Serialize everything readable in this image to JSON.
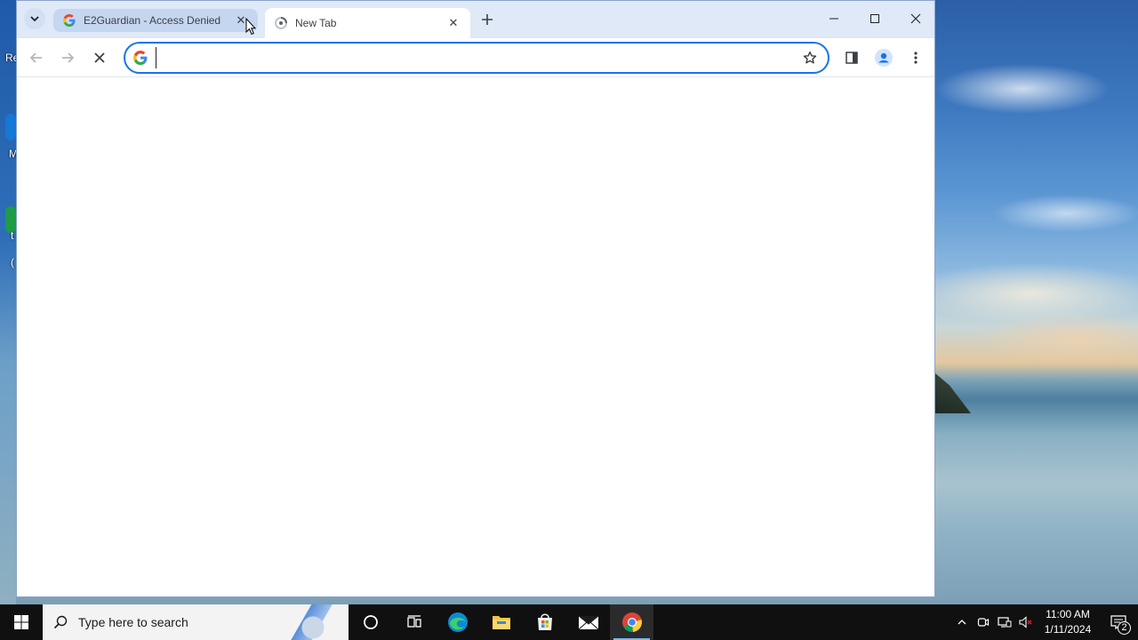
{
  "desktop": {
    "left_edge_label_fragment": "Re",
    "fragment_2": "M",
    "fragment_3": "t",
    "fragment_4": "("
  },
  "browser": {
    "tabs": [
      {
        "title": "E2Guardian - Access Denied",
        "favicon": "google-g-icon",
        "state": "inactive",
        "close_label": "✕"
      },
      {
        "title": "New Tab",
        "favicon": "loading-spinner-icon",
        "state": "active",
        "close_label": "✕"
      }
    ],
    "new_tab_label": "+",
    "window_controls": {
      "minimize": "minimize-icon",
      "maximize": "maximize-icon",
      "close": "close-icon"
    },
    "toolbar": {
      "back": "back-arrow-icon",
      "forward": "forward-arrow-icon",
      "stop": "stop-loading-icon",
      "address_value": "",
      "address_placeholder": "",
      "bookmark": "star-outline-icon",
      "side_panel": "side-panel-icon",
      "profile": "profile-avatar-icon",
      "menu": "kebab-menu-icon"
    },
    "colors": {
      "accent": "#1a73e8",
      "tabstrip": "#dfe9f7"
    }
  },
  "taskbar": {
    "search_placeholder": "Type here to search",
    "pinned": [
      "cortana-circle-icon",
      "task-view-icon",
      "edge-icon",
      "file-explorer-icon",
      "microsoft-store-icon",
      "mail-icon",
      "chrome-icon"
    ],
    "active_app": "chrome-icon",
    "tray": [
      "chevron-up-icon",
      "meet-now-icon",
      "network-icon",
      "volume-muted-icon"
    ],
    "time": "11:00 AM",
    "date": "1/11/2024",
    "notification_count": "2"
  }
}
